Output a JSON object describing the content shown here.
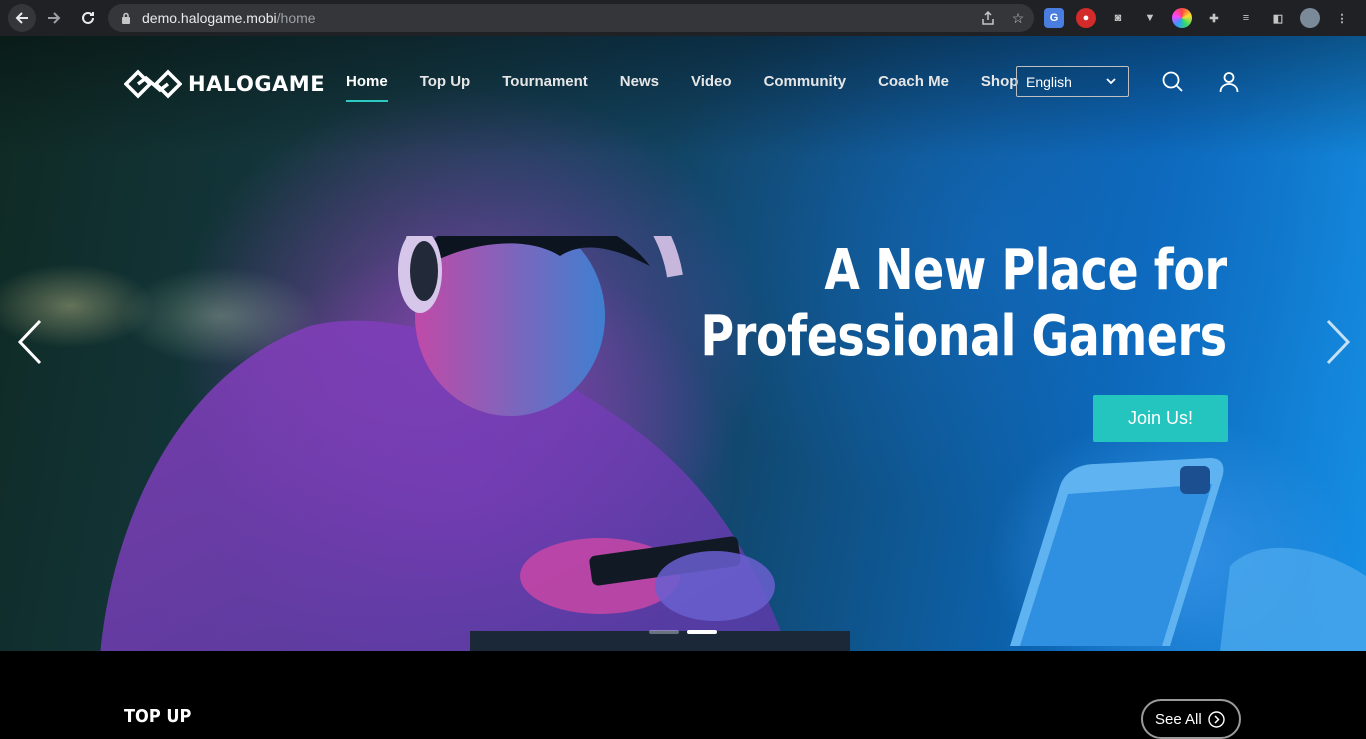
{
  "browser": {
    "url_host": "demo.halogame.mobi",
    "url_path": "/home"
  },
  "site": {
    "logo_text": "HALOGAME",
    "menu": [
      {
        "label": "Home",
        "active": true
      },
      {
        "label": "Top Up"
      },
      {
        "label": "Tournament"
      },
      {
        "label": "News"
      },
      {
        "label": "Video"
      },
      {
        "label": "Community"
      },
      {
        "label": "Coach Me"
      },
      {
        "label": "Shop"
      }
    ],
    "language": "English"
  },
  "hero": {
    "headline_line1": "A New Place for",
    "headline_line2": "Professional Gamers",
    "cta_label": "Join Us!",
    "slides": 2,
    "active_slide": 2
  },
  "section": {
    "title": "TOP UP",
    "see_all_label": "See All"
  },
  "colors": {
    "accent": "#25c5bf",
    "chrome_bg": "#202124"
  }
}
